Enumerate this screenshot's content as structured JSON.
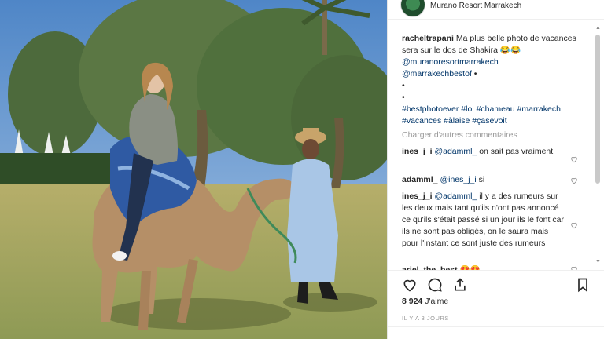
{
  "post": {
    "account_name": "Murano Resort Marrakech",
    "caption": {
      "username": "racheltrapani",
      "line1": "Ma plus belle photo de vacances sera sur le dos de Shakira 😂😂",
      "mention1": "@muranoresortmarrakech",
      "mention2": "@marrakechbestof",
      "mention2_suffix": " •",
      "dot1": "•",
      "dot2": "•",
      "hashtags_line1": "#bestphotoever #lol #chameau #marrakech",
      "hashtags_line2": "#vacances #àlaise #çasevoit"
    },
    "load_more_label": "Charger d'autres commentaires",
    "comments": [
      {
        "username": "ines_j_i",
        "mention": "@adamml_",
        "text": " on sait pas vraiment"
      },
      {
        "username": "adamml_",
        "mention": "@ines_j_i",
        "text": " si"
      },
      {
        "username": "ines_j_i",
        "mention": "@adamml_",
        "text": " il y a des rumeurs sur les deux mais tant qu'ils n'ont pas annoncé ce qu'ils s'était passé si un jour ils le font car ils ne sont pas obligés, on le saura mais pour l'instant ce sont juste des rumeurs"
      },
      {
        "username": "ariel_the_best",
        "mention": "",
        "text": " 😍😍"
      }
    ],
    "likes_count": "8 924",
    "likes_label": "J'aime",
    "timestamp": "il y a 3 jours"
  },
  "icons": {
    "like": "heart-icon",
    "comment": "comment-bubble-icon",
    "share": "share-icon",
    "save": "bookmark-icon",
    "comment_like": "heart-icon"
  },
  "colors": {
    "link": "#003569",
    "text": "#262626",
    "muted": "#999999"
  }
}
